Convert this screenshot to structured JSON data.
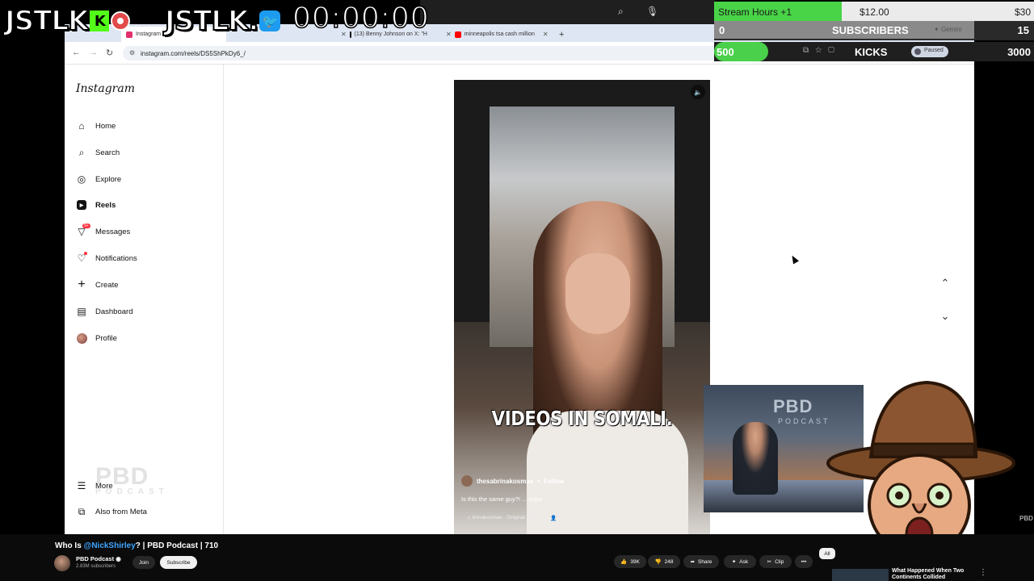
{
  "overlay": {
    "logo_left": "JSTLK",
    "logo_left_badge": "K",
    "logo_right": "JSTLK.",
    "timer": "00:00:00",
    "goals": {
      "stream_hours": {
        "label": "Stream Hours +1",
        "current": "$12.00",
        "target": "$30",
        "progress": 0.4
      },
      "subscribers": {
        "current": "0",
        "label": "SUBSCRIBERS",
        "target": "15",
        "progress": 0.0
      },
      "kicks": {
        "current": "500",
        "label": "KICKS",
        "target": "3000",
        "progress": 0.17
      }
    },
    "browser_extras": {
      "gemini": "Gemini",
      "paused": "Paused"
    }
  },
  "browser": {
    "tabs": [
      {
        "label": "Instagram",
        "active": true
      },
      {
        "label": "(13) Benny Johnson on X: \"H",
        "active": false
      },
      {
        "label": "minneapolis tsa cash million",
        "active": false
      }
    ],
    "new_tab": "+",
    "url": "instagram.com/reels/DS5ShPkDy6_/"
  },
  "instagram": {
    "logo": "Instagram",
    "nav": [
      {
        "label": "Home",
        "icon": "home-icon",
        "glyph": "⌂"
      },
      {
        "label": "Search",
        "icon": "search-icon",
        "glyph": "⌕"
      },
      {
        "label": "Explore",
        "icon": "explore-icon",
        "glyph": "◎"
      },
      {
        "label": "Reels",
        "icon": "reels-icon",
        "glyph": "▶"
      },
      {
        "label": "Messages",
        "icon": "messages-icon",
        "glyph": "▽"
      },
      {
        "label": "Notifications",
        "icon": "heart-icon",
        "glyph": "♡"
      },
      {
        "label": "Create",
        "icon": "plus-icon",
        "glyph": "+"
      },
      {
        "label": "Dashboard",
        "icon": "dashboard-icon",
        "glyph": "▤"
      },
      {
        "label": "Profile",
        "icon": "profile-avatar-icon",
        "glyph": ""
      }
    ],
    "messages_badge": "9+",
    "more_label": "More",
    "meta_label": "Also from Meta",
    "watermark": "PBD",
    "watermark_sub": "PODCAST",
    "reel": {
      "caption": "VIDEOS IN SOMALI.",
      "username": "thesabrinakosmas",
      "follow": "Follow",
      "description": "Is this the same guy?! ... more",
      "audio": "brinakosmas · Original audio",
      "people": "2 people"
    }
  },
  "webcam": {
    "brand": "PBD",
    "brand_sub": "PODCAST"
  },
  "youtube": {
    "title_prefix": "Who Is ",
    "title_mention": "@NickShirley",
    "title_suffix": "? | PBD Podcast | 710",
    "channel": "PBD Podcast",
    "subscribers": "2.83M subscribers",
    "join": "Join",
    "subscribe": "Subscribe",
    "likes": "39K",
    "dislikes": "248",
    "share": "Share",
    "ask": "Ask",
    "clip": "Clip",
    "filter_all": "All",
    "next_title_1": "What Happened When Two",
    "next_title_2": "Continents Collided",
    "corner_brand": "PBD"
  }
}
